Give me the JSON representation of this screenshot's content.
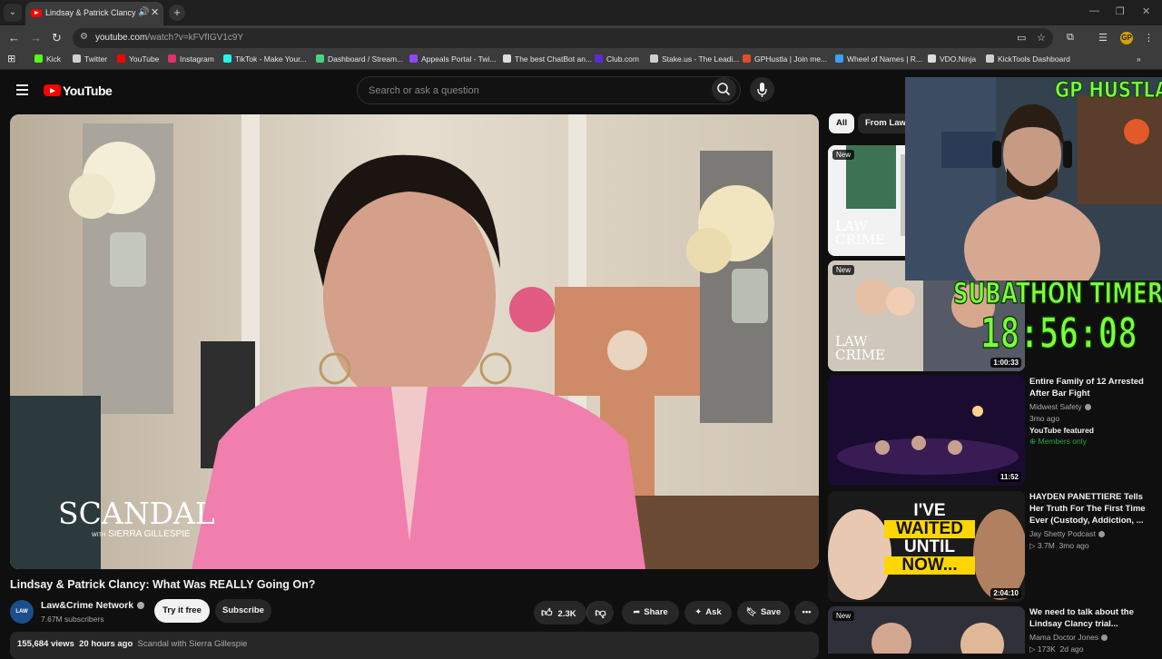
{
  "browser": {
    "tab_title": "Lindsay & Patrick Clancy: W",
    "address": {
      "domain": "youtube.com",
      "path": "/watch?v=kFVfIGV1c9Y"
    },
    "bookmarks": [
      {
        "label": "Kick",
        "color": "#53fc18"
      },
      {
        "label": "Twitter",
        "color": "#cfcfcf"
      },
      {
        "label": "YouTube",
        "color": "#ff0000"
      },
      {
        "label": "Instagram",
        "color": "#e1306c"
      },
      {
        "label": "TikTok - Make Your...",
        "color": "#25f4ee"
      },
      {
        "label": "Dashboard / Stream...",
        "color": "#45d483"
      },
      {
        "label": "Appeals Portal - Twi...",
        "color": "#9146ff"
      },
      {
        "label": "The best ChatBot an...",
        "color": "#dddddd"
      },
      {
        "label": "Club.com",
        "color": "#5b2bd6"
      },
      {
        "label": "Stake.us - The Leadi...",
        "color": "#cfcfcf"
      },
      {
        "label": "GPHustla | Join me...",
        "color": "#e34c26"
      },
      {
        "label": "Wheel of Names | R...",
        "color": "#3aa0ff"
      },
      {
        "label": "VDO.Ninja",
        "color": "#dddddd"
      },
      {
        "label": "KickTools Dashboard",
        "color": "#cfcfcf"
      }
    ],
    "profile_initial": "GP"
  },
  "youtube": {
    "logo": "YouTube",
    "search_placeholder": "Search or ask a question"
  },
  "video": {
    "overlay_brand": "SCANDAL",
    "overlay_with": "WITH",
    "overlay_host": "SIERRA GILLESPIE",
    "title": "Lindsay & Patrick Clancy: What Was REALLY Going On?",
    "channel": "Law&Crime Network",
    "channel_avatar": "LAW CRIME",
    "subscribers": "7.67M subscribers",
    "try_label": "Try it free",
    "subscribe_label": "Subscribe",
    "likes": "2.3K",
    "share_label": "Share",
    "ask_label": "Ask",
    "save_label": "Save",
    "views": "155,684 views",
    "age": "20 hours ago",
    "playlist": "Scandal with Sierra Gillespie"
  },
  "sidebar": {
    "chips": [
      "All",
      "From Law&"
    ],
    "badge_new": "New",
    "thumb1_brand": "LAW CRIME",
    "thumb2_duration": "1:00:33",
    "videos": [
      {
        "title": "Entire Family of 12 Arrested After Bar Fight",
        "channel": "Midwest Safety",
        "age": "3mo ago",
        "featured": "YouTube featured",
        "members": "Members only",
        "duration": "11:52"
      },
      {
        "title": "HAYDEN PANETTIERE Tells Her Truth For The First Time Ever (Custody, Addiction, ...",
        "channel": "Jay Shetty Podcast",
        "stats": "3.7M",
        "age": "3mo ago",
        "thumb_text_1": "I'VE",
        "thumb_text_2": "WAITED",
        "thumb_text_3": "UNTIL",
        "thumb_text_4": "NOW...",
        "duration": "2:04:10"
      },
      {
        "title": "We need to talk about the Lindsay Clancy trial...",
        "channel": "Mama Doctor Jones",
        "stats": "173K",
        "age": "2d ago"
      }
    ]
  },
  "stream_overlay": {
    "cam_title": "GP HUSTLA",
    "subathon_label": "SUBATHON TIMER",
    "timer": "18:56:08"
  },
  "colors": {
    "accent_green": "#7cff3a",
    "youtube_red": "#ff0000",
    "background": "#0f0f0f"
  }
}
